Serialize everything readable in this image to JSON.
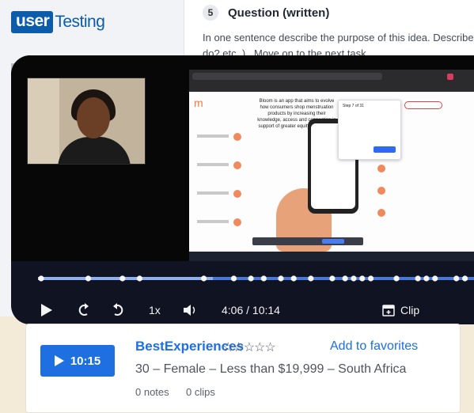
{
  "app": {
    "logo_strong": "user",
    "logo_rest": "Testing"
  },
  "task": {
    "number": "5",
    "title": "Question (written)",
    "line1": "In one sentence describe the purpose of this idea. Describe it (",
    "line2": "do? etc. ) . Move on to the next task."
  },
  "recording": {
    "brand_letter": "m",
    "intro": "Bloom is an app that aims to evolve how consumers shop menstruation products by increasing their knowledge, access and connection in support of greater equity and justice.",
    "step_popup_title": "Step 7 of 31",
    "step_popup_button": "Next Step"
  },
  "player": {
    "play_icon": "play-icon",
    "rewind_icon": "rewind-icon",
    "forward_icon": "forward-icon",
    "speed": "1x",
    "volume_icon": "volume-icon",
    "time": "4:06 / 10:14",
    "clip_label": "Clip",
    "progress": 0.401
  },
  "session": {
    "duration": "10:15",
    "name": "BestExperiences",
    "stars": "☆☆☆☆☆",
    "favorites": "Add to favorites",
    "demographics": "30 – Female – Less than $19,999 – South Africa",
    "notes": "0 notes",
    "clips": "0 clips"
  },
  "colors": {
    "accent": "#1e6fe0",
    "timeline": "#4a78d6",
    "player_bg": "#0f1322",
    "card_bg": "#ffffff",
    "page_bg": "#f3ead8"
  }
}
